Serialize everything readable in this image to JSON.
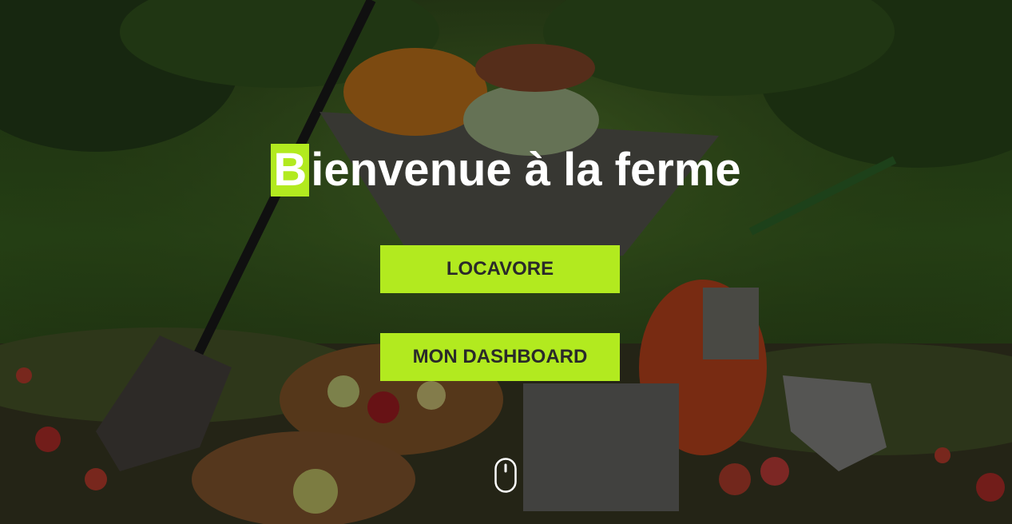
{
  "hero": {
    "title_first_letter": "B",
    "title_rest": "ienvenue à la ferme",
    "accent_color": "#b2ea1f",
    "background_image": "farm-garden-vegetables-wheelbarrow"
  },
  "buttons": {
    "locavore_label": "LOCAVORE",
    "dashboard_label": "MON DASHBOARD"
  },
  "scroll": {
    "icon": "mouse-scroll-icon"
  }
}
